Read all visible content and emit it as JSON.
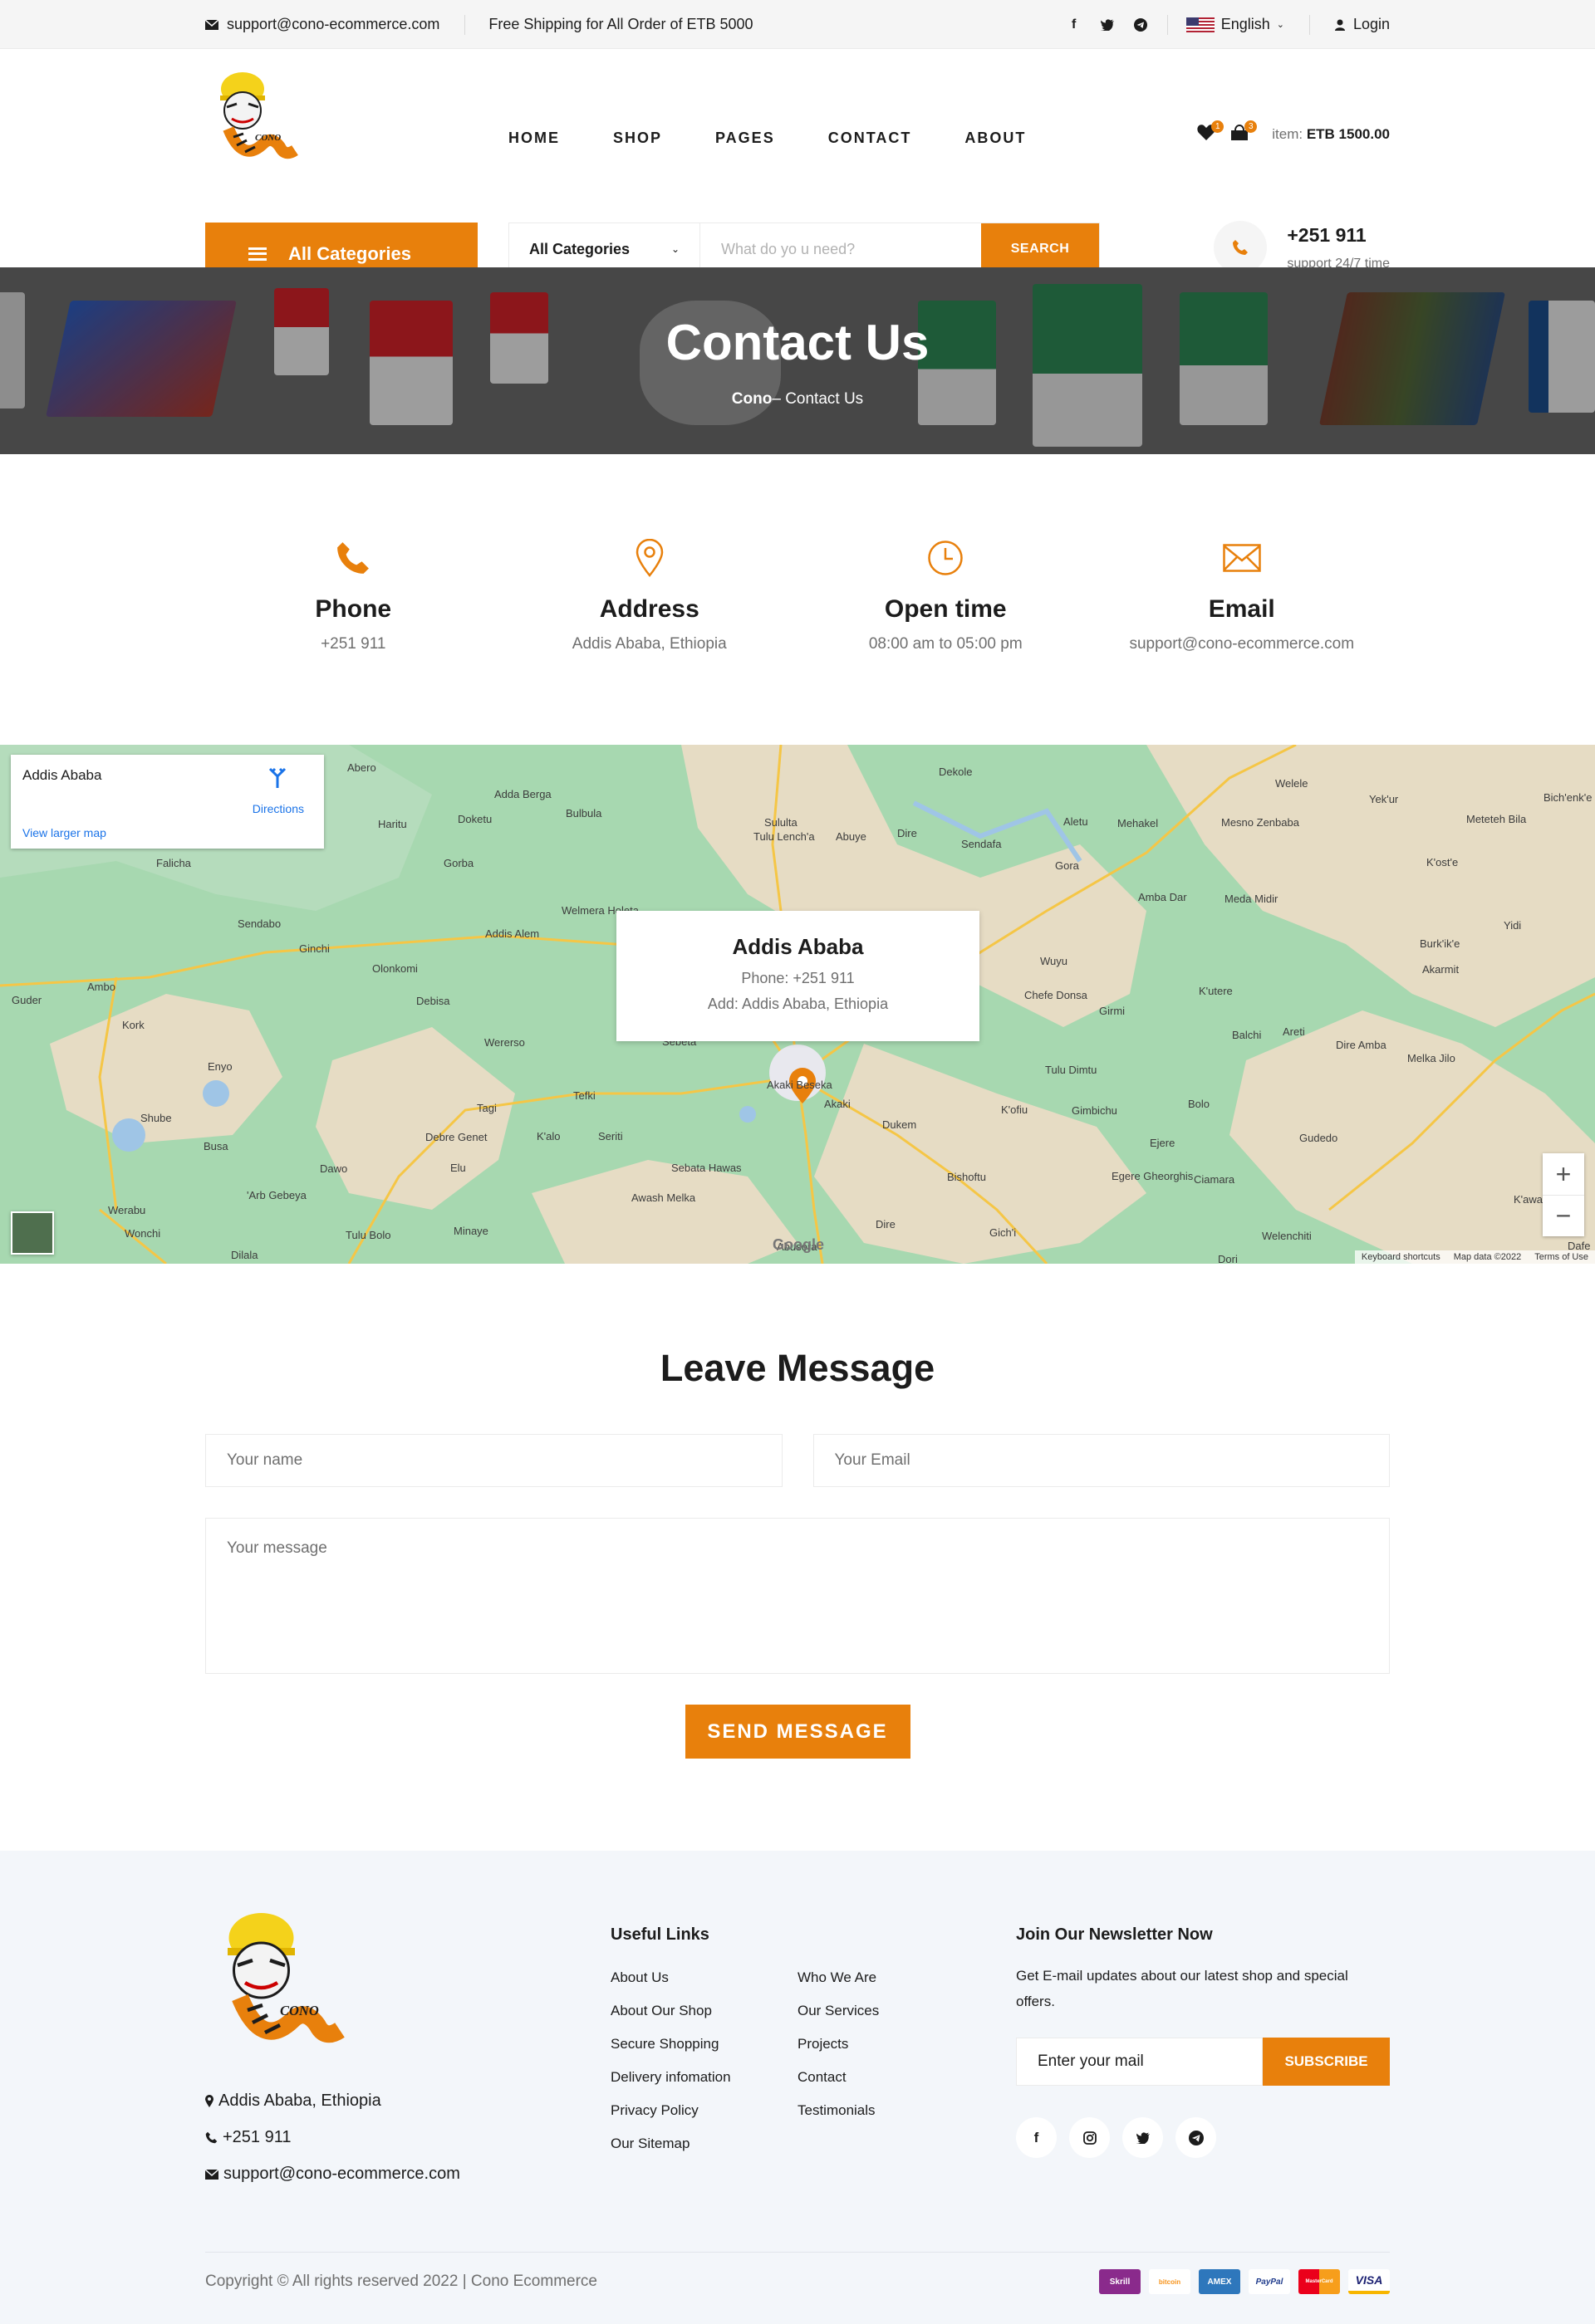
{
  "topbar": {
    "email": "support@cono-ecommerce.com",
    "shipping": "Free Shipping for All Order of ETB 5000",
    "language": "English",
    "login": "Login"
  },
  "header": {
    "nav": [
      "HOME",
      "SHOP",
      "PAGES",
      "CONTACT",
      "ABOUT"
    ],
    "wishlist_count": "1",
    "cart_count": "3",
    "item_label": "item:",
    "item_total": "ETB 1500.00",
    "all_categories": "All Categories",
    "search_category": "All Categories",
    "search_placeholder": "What do yo u need?",
    "search_button": "SEARCH",
    "phone": "+251 911",
    "support": "support 24/7 time",
    "logo_text": "CONO"
  },
  "hero": {
    "title": "Contact Us",
    "crumb_home": "Cono",
    "crumb_sep": "–",
    "crumb_current": "Contact Us"
  },
  "info": [
    {
      "title": "Phone",
      "value": "+251 911",
      "icon": "phone-icon"
    },
    {
      "title": "Address",
      "value": "Addis Ababa, Ethiopia",
      "icon": "location-pin-icon"
    },
    {
      "title": "Open time",
      "value": "08:00 am to 05:00 pm",
      "icon": "clock-icon"
    },
    {
      "title": "Email",
      "value": "support@cono-ecommerce.com",
      "icon": "envelope-icon"
    }
  ],
  "map": {
    "card_title": "Addis Ababa",
    "directions": "Directions",
    "view_larger": "View larger map",
    "popup_title": "Addis Ababa",
    "popup_phone": "Phone: +251 911",
    "popup_address": "Add: Addis Ababa, Ethiopia",
    "google": "Google",
    "attribution": [
      "Keyboard shortcuts",
      "Map data ©2022",
      "Terms of Use"
    ],
    "places": [
      "Abero",
      "Adda Berga",
      "Bulbula",
      "Dekole",
      "Welele",
      "Yek'ur",
      "Bich'enk'e",
      "Meteteh Bila",
      "Doketu",
      "Haritu",
      "Sululta",
      "Dire",
      "Aletu",
      "Mehakel",
      "Mesno Zenbaba",
      "K'ost'e",
      "Falicha",
      "Gorba",
      "Tulu Lench'a",
      "Abuye",
      "Sendafa",
      "Gora",
      "Amba Dar",
      "Meda Midir",
      "Yidi",
      "Sendabo",
      "Ginchi",
      "Wuyu",
      "Burk'ik'e",
      "Addis Alem",
      "Welmera Holeta",
      "Akarmit",
      "Olonkomi",
      "Debisa",
      "Chefe Donsa",
      "Girmi",
      "K'utere",
      "Ambo",
      "Kork",
      "Guder",
      "Wererso",
      "Balchi",
      "Areti",
      "Dire Amba",
      "Melka Jilo",
      "Enyo",
      "Sebeta",
      "Tulu Dimtu",
      "Tagi",
      "Tefki",
      "Akaki Beseka",
      "Akaki",
      "K'ofiu",
      "Gimbichu",
      "Bolo",
      "Shube",
      "Gudedo",
      "Debre Genet",
      "K'alo",
      "Seriti",
      "Dukem",
      "Ejere",
      "Busa",
      "Dawo",
      "Elu",
      "Sebata Hawas",
      "Bishoftu",
      "Egere Gheorghis",
      "Ciamara",
      "K'awa Gebeya",
      "'Arb Gebeya",
      "Awash Melka",
      "Werabu",
      "Wonchi",
      "Tulu Bolo",
      "Minaye",
      "Dire",
      "Abusora",
      "Gich'i",
      "Welenchiti",
      "Dilala",
      "Dori",
      "Dafe"
    ]
  },
  "leave": {
    "title": "Leave Message",
    "name_ph": "Your name",
    "email_ph": "Your Email",
    "message_ph": "Your message",
    "button": "SEND MESSAGE"
  },
  "footer": {
    "address": "Addis Ababa, Ethiopia",
    "phone": "+251 911",
    "email": "support@cono-ecommerce.com",
    "links_title": "Useful Links",
    "links_col1": [
      "About Us",
      "About Our Shop",
      "Secure Shopping",
      "Delivery infomation",
      "Privacy Policy",
      "Our Sitemap"
    ],
    "links_col2": [
      "Who We Are",
      "Our Services",
      "Projects",
      "Contact",
      "Testimonials"
    ],
    "news_title": "Join Our Newsletter Now",
    "news_text": "Get E-mail updates about our latest shop and special offers.",
    "news_ph": "Enter your mail",
    "news_button": "SUBSCRIBE",
    "copyright": "Copyright © All rights reserved 2022 | Cono Ecommerce",
    "payments": [
      "Skrill",
      "bitcoin",
      "AMEX",
      "PayPal",
      "MasterCard",
      "VISA"
    ]
  },
  "colors": {
    "accent": "#e8800c",
    "footer_bg": "#f3f6fa",
    "map_green": "#a7d8b0"
  }
}
